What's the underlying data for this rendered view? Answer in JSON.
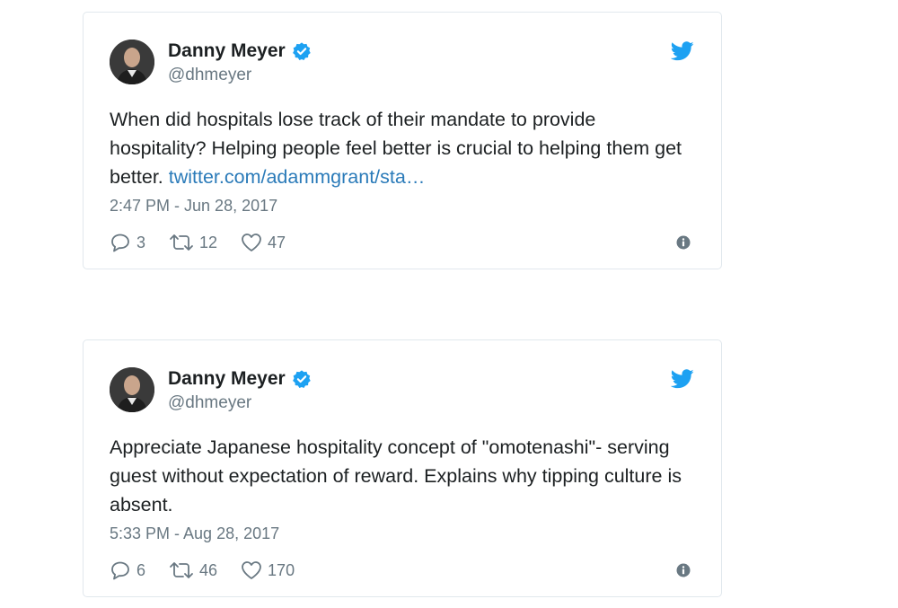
{
  "colors": {
    "border": "#e1e8ed",
    "text": "#1c2022",
    "muted": "#697882",
    "link": "#2b7bb9",
    "twitter_blue": "#1da1f2",
    "verified_blue": "#1da1f2"
  },
  "tweets": [
    {
      "author": {
        "name": "Danny Meyer",
        "handle": "@dhmeyer",
        "verified": true
      },
      "text": "When did hospitals lose track of their mandate to provide hospitality? Helping people feel better is crucial to helping them get better. ",
      "link": "twitter.com/adammgrant/sta…",
      "timestamp": "2:47 PM - Jun 28, 2017",
      "replies": "3",
      "retweets": "12",
      "likes": "47",
      "icons": [
        "reply-icon",
        "retweet-icon",
        "heart-icon",
        "info-icon",
        "twitter-bird-icon",
        "verified-badge-icon"
      ]
    },
    {
      "author": {
        "name": "Danny Meyer",
        "handle": "@dhmeyer",
        "verified": true
      },
      "text": "Appreciate Japanese hospitality concept of \"omotenashi\"- serving guest without expectation of reward. Explains why tipping culture is absent.",
      "link": "",
      "timestamp": "5:33 PM - Aug 28, 2017",
      "replies": "6",
      "retweets": "46",
      "likes": "170",
      "icons": [
        "reply-icon",
        "retweet-icon",
        "heart-icon",
        "info-icon",
        "twitter-bird-icon",
        "verified-badge-icon"
      ]
    }
  ]
}
